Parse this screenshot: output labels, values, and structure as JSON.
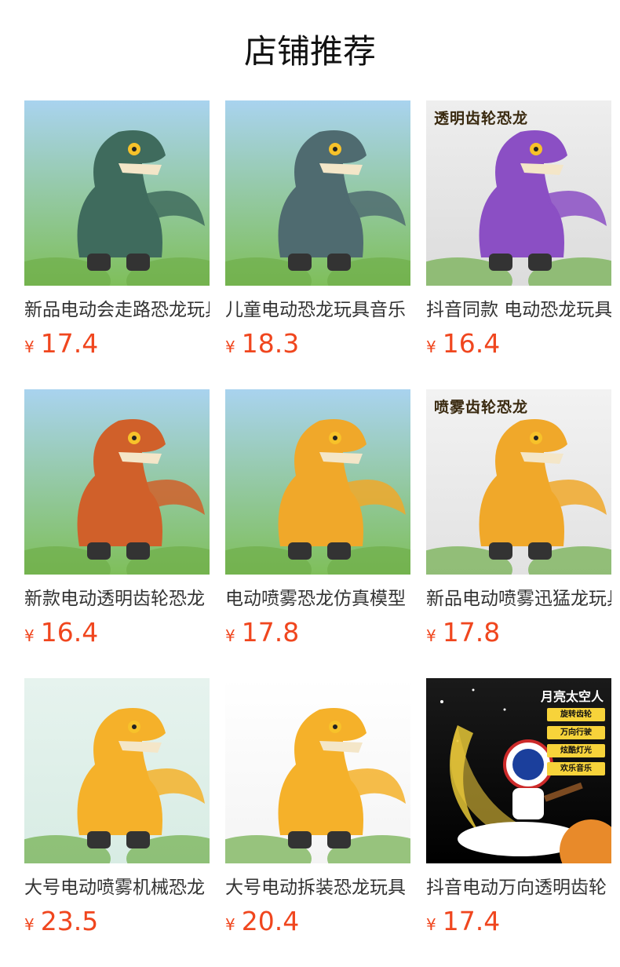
{
  "page": {
    "title": "店铺推荐"
  },
  "products": [
    {
      "name": "新品电动会走路恐龙玩具",
      "currency": "¥",
      "price": "17.4",
      "image_caption": "",
      "colors": {
        "bg_top": "#a9d3ef",
        "bg_bottom": "#7fbf5a",
        "body": "#3f6b5d"
      }
    },
    {
      "name": "儿童电动恐龙玩具音乐",
      "currency": "¥",
      "price": "18.3",
      "image_caption": "",
      "colors": {
        "bg_top": "#a9d3ef",
        "bg_bottom": "#7fbf5a",
        "body": "#4f6b70"
      }
    },
    {
      "name": "抖音同款 电动恐龙玩具",
      "currency": "¥",
      "price": "16.4",
      "image_caption": "透明齿轮恐龙",
      "colors": {
        "bg_top": "#eeeeee",
        "bg_bottom": "#dcdcdc",
        "body": "#8b4fc4"
      }
    },
    {
      "name": "新款电动透明齿轮恐龙",
      "currency": "¥",
      "price": "16.4",
      "image_caption": "",
      "colors": {
        "bg_top": "#a9d3ef",
        "bg_bottom": "#7fbf5a",
        "body": "#d0602a"
      }
    },
    {
      "name": "电动喷雾恐龙仿真模型",
      "currency": "¥",
      "price": "17.8",
      "image_caption": "",
      "colors": {
        "bg_top": "#a9d3ef",
        "bg_bottom": "#7fbf5a",
        "body": "#f0a82a"
      }
    },
    {
      "name": "新品电动喷雾迅猛龙玩具",
      "currency": "¥",
      "price": "17.8",
      "image_caption": "喷雾齿轮恐龙",
      "colors": {
        "bg_top": "#f2f2f2",
        "bg_bottom": "#e2e2e2",
        "body": "#f0a82a"
      }
    },
    {
      "name": "大号电动喷雾机械恐龙",
      "currency": "¥",
      "price": "23.5",
      "image_caption": "",
      "colors": {
        "bg_top": "#e6f3ee",
        "bg_bottom": "#d8ece4",
        "body": "#f5b12a"
      }
    },
    {
      "name": "大号电动拆装恐龙玩具",
      "currency": "¥",
      "price": "20.4",
      "image_caption": "",
      "colors": {
        "bg_top": "#ffffff",
        "bg_bottom": "#f4f4f4",
        "body": "#f5b12a"
      }
    },
    {
      "name": "抖音电动万向透明齿轮",
      "currency": "¥",
      "price": "17.4",
      "image_caption": "月亮太空人",
      "badges": [
        "旋转齿轮",
        "万向行驶",
        "炫酷灯光",
        "欢乐音乐"
      ],
      "colors": {
        "bg_top": "#1a1a1a",
        "bg_bottom": "#000000",
        "body": "#f2d23a"
      }
    }
  ]
}
